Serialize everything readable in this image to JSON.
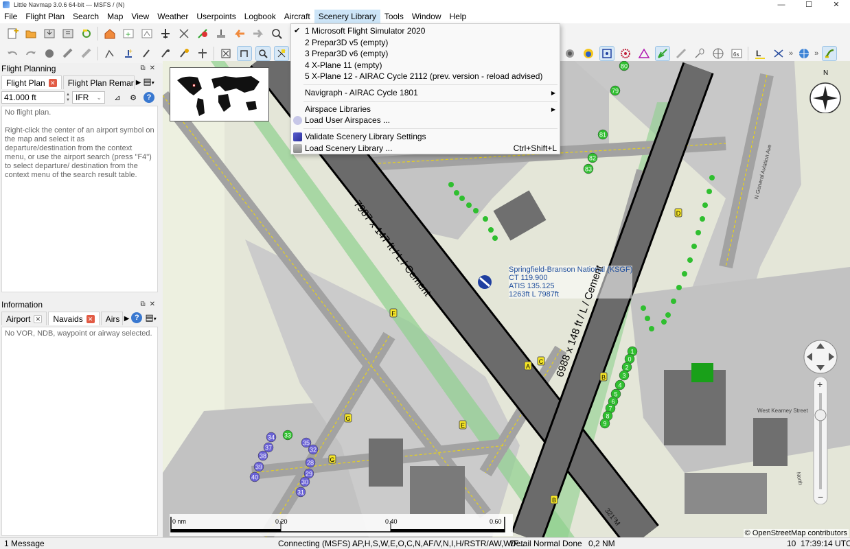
{
  "window": {
    "title": "Little Navmap 3.0.6 64-bit — MSFS / (N)",
    "controls": [
      "—",
      "☐",
      "✕"
    ]
  },
  "menubar": [
    "File",
    "Flight Plan",
    "Search",
    "Map",
    "View",
    "Weather",
    "Userpoints",
    "Logbook",
    "Aircraft",
    "Scenery Library",
    "Tools",
    "Window",
    "Help"
  ],
  "scenery_menu": {
    "sim_items": [
      {
        "label": "1 Microsoft Flight Simulator 2020",
        "checked": true
      },
      {
        "label": "2 Prepar3D v5 (empty)",
        "checked": false
      },
      {
        "label": "3 Prepar3D v6 (empty)",
        "checked": false
      },
      {
        "label": "4 X-Plane 11 (empty)",
        "checked": false
      },
      {
        "label": "5 X-Plane 12 - AIRAC Cycle 2112 (prev. version - reload advised)",
        "checked": false
      }
    ],
    "navigraph": "Navigraph - AIRAC Cycle 1801",
    "airspace_libraries": "Airspace Libraries",
    "load_user_airspaces": "Load User Airspaces ...",
    "validate": "Validate Scenery Library Settings",
    "load_scenery": "Load Scenery Library ...",
    "load_scenery_shortcut": "Ctrl+Shift+L"
  },
  "flight_planning": {
    "title": "Flight Planning",
    "tabs": [
      "Flight Plan",
      "Flight Plan Remarks"
    ],
    "altitude": "41.000 ft",
    "rule": "IFR",
    "no_plan": "No flight plan.",
    "help_text": "Right-click the center of an airport symbol on the map and select it as departure/destination from the context menu, or use the airport search (press \"F4\") to select departure/ destination from the context menu of the search result table."
  },
  "information": {
    "title": "Information",
    "tabs": [
      "Airport",
      "Navaids",
      "Airs"
    ],
    "message": "No VOR, NDB, waypoint or airway selected."
  },
  "map": {
    "airport_label": [
      "Springfield-Branson National (KSGF)",
      "CT 119.900",
      "ATIS 135.125",
      "1263ft L 7987ft"
    ],
    "runway1": "7987 x 147 ft / L / Cement",
    "runway2": "6988 x 148 ft / L / Cement",
    "road1": "West Kearney Street",
    "road2": "N General Aviation Ave",
    "road3": "North",
    "taxiways": [
      "F",
      "G",
      "G",
      "E",
      "A",
      "C",
      "B",
      "B",
      "D"
    ],
    "gates_blue": [
      "34",
      "37",
      "38",
      "39",
      "40",
      "35",
      "32",
      "28",
      "29",
      "30",
      "31"
    ],
    "gates_green_left": [
      "33"
    ],
    "gates_green_top": [
      "80",
      "79",
      "81",
      "82",
      "83"
    ],
    "gates_green_right": [
      "1",
      "0",
      "2",
      "3",
      "4",
      "5",
      "6",
      "7",
      "8",
      "9"
    ],
    "heading_label": "321°M",
    "scale": [
      "0 nm",
      "0.20",
      "0.40",
      "0.60"
    ],
    "attribution": "© OpenStreetMap contributors",
    "compass_label": "N"
  },
  "statusbar": {
    "message": "1 Message",
    "connection": "Connecting (MSFS) ...",
    "layers": "AP,H,S,W,E,O,C,N,AF/V,N,I,H/RSTR/AW,W/F...",
    "detail": "Detail Normal",
    "done": "Done",
    "distance": "0,2 NM",
    "num": "10",
    "time": "17:39:14 UTC"
  },
  "colors": {
    "menu_highlight": "#cce4f7",
    "runway": "#555555",
    "apron": "#bdbdbd",
    "grass": "#e4e6d8",
    "gate_blue": "#6a62d6",
    "gate_green": "#2fbf2f",
    "taxi_yellow": "#e8d21a",
    "close_red": "#e25b45"
  }
}
